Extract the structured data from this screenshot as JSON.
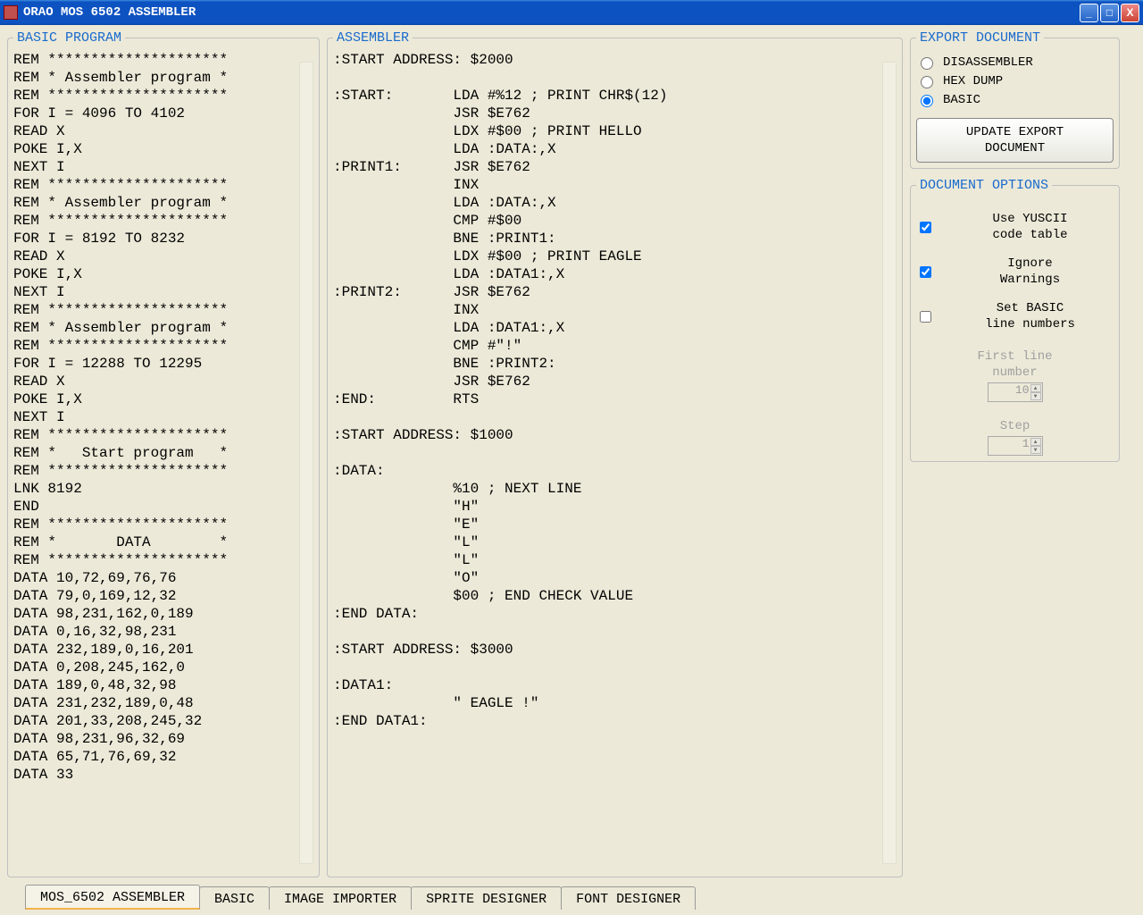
{
  "title": "ORAO  MOS 6502 ASSEMBLER",
  "panels": {
    "basic": {
      "legend": "BASIC PROGRAM"
    },
    "asm": {
      "legend": "ASSEMBLER"
    },
    "export": {
      "legend": "EXPORT DOCUMENT"
    },
    "docopt": {
      "legend": "DOCUMENT OPTIONS"
    }
  },
  "basic_code": "REM *********************\nREM * Assembler program *\nREM *********************\nFOR I = 4096 TO 4102\nREAD X\nPOKE I,X\nNEXT I\nREM *********************\nREM * Assembler program *\nREM *********************\nFOR I = 8192 TO 8232\nREAD X\nPOKE I,X\nNEXT I\nREM *********************\nREM * Assembler program *\nREM *********************\nFOR I = 12288 TO 12295\nREAD X\nPOKE I,X\nNEXT I\nREM *********************\nREM *   Start program   *\nREM *********************\nLNK 8192\nEND\nREM *********************\nREM *       DATA        *\nREM *********************\nDATA 10,72,69,76,76\nDATA 79,0,169,12,32\nDATA 98,231,162,0,189\nDATA 0,16,32,98,231\nDATA 232,189,0,16,201\nDATA 0,208,245,162,0\nDATA 189,0,48,32,98\nDATA 231,232,189,0,48\nDATA 201,33,208,245,32\nDATA 98,231,96,32,69\nDATA 65,71,76,69,32\nDATA 33",
  "asm_code": ":START ADDRESS: $2000\n\n:START:       LDA #%12 ; PRINT CHR$(12)\n              JSR $E762\n              LDX #$00 ; PRINT HELLO\n              LDA :DATA:,X\n:PRINT1:      JSR $E762\n              INX\n              LDA :DATA:,X\n              CMP #$00\n              BNE :PRINT1:\n              LDX #$00 ; PRINT EAGLE\n              LDA :DATA1:,X\n:PRINT2:      JSR $E762\n              INX\n              LDA :DATA1:,X\n              CMP #\"!\"\n              BNE :PRINT2:\n              JSR $E762\n:END:         RTS\n\n:START ADDRESS: $1000\n\n:DATA:\n              %10 ; NEXT LINE\n              \"H\"\n              \"E\"\n              \"L\"\n              \"L\"\n              \"O\"\n              $00 ; END CHECK VALUE\n:END DATA:\n\n:START ADDRESS: $3000\n\n:DATA1:\n              \" EAGLE !\"\n:END DATA1:",
  "export": {
    "r1": "DISASSEMBLER",
    "r2": "HEX DUMP",
    "r3": "BASIC",
    "btn": "UPDATE EXPORT\nDOCUMENT"
  },
  "docopt": {
    "c1": "Use YUSCII\ncode table",
    "c2": "Ignore\nWarnings",
    "c3": "Set BASIC\nline numbers",
    "first_label": "First line\nnumber",
    "first_value": "10",
    "step_label": "Step",
    "step_value": "1"
  },
  "tabs": {
    "t0": "MOS_6502 ASSEMBLER",
    "t1": "BASIC",
    "t2": "IMAGE IMPORTER",
    "t3": "SPRITE DESIGNER",
    "t4": "FONT DESIGNER"
  }
}
